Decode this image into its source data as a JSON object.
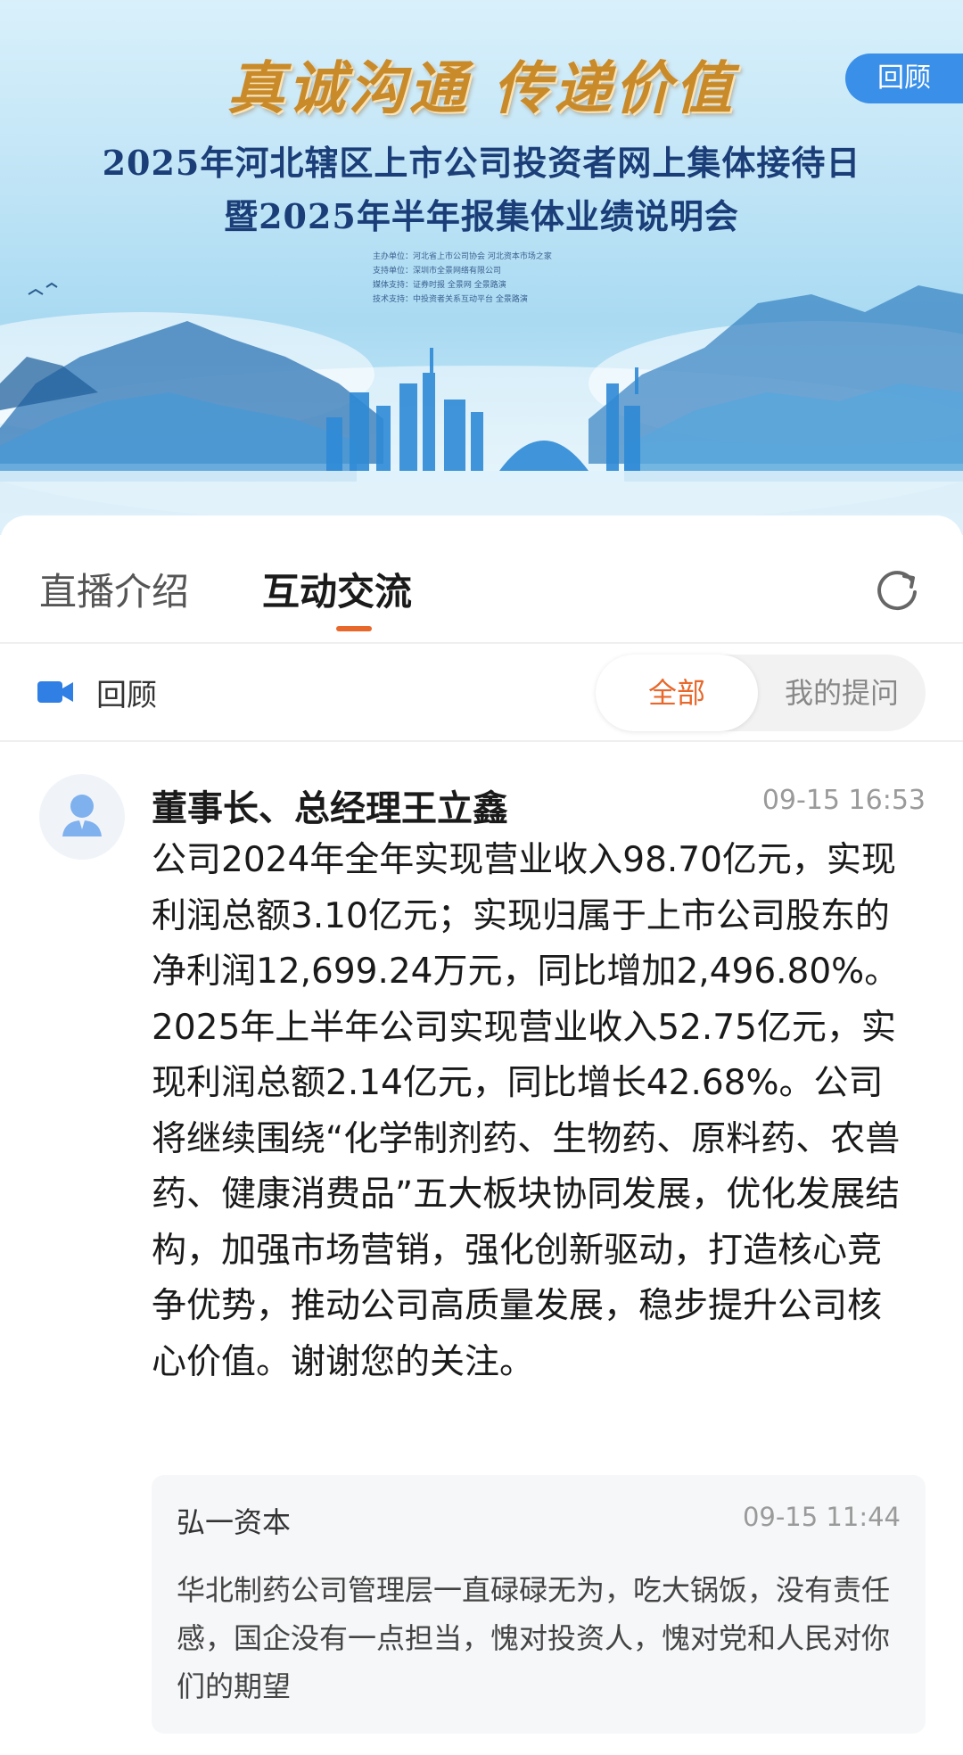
{
  "banner": {
    "slogan": "真诚沟通  传递价值",
    "title_line1": "2025年河北辖区上市公司投资者网上集体接待日",
    "title_line2": "暨2025年半年报集体业绩说明会",
    "credits": [
      "主办单位：河北省上市公司协会  河北资本市场之家",
      "支持单位：深圳市全景网络有限公司",
      "媒体支持：证券时报  全景网  全景路演",
      "技术支持：中投资者关系互动平台  全景路演"
    ],
    "review_label": "回顾"
  },
  "tabs": {
    "intro": "直播介绍",
    "interaction": "互动交流"
  },
  "filter": {
    "label": "回顾",
    "all": "全部",
    "mine": "我的提问"
  },
  "answer": {
    "author": "董事长、总经理王立鑫",
    "time": "09-15 16:53",
    "text": "公司2024年全年实现营业收入98.70亿元，实现利润总额3.10亿元；实现归属于上市公司股东的净利润12,699.24万元，同比增加2,496.80%。2025年上半年公司实现营业收入52.75亿元，实现利润总额2.14亿元，同比增长42.68%。公司将继续围绕“化学制剂药、生物药、原料药、农兽药、健康消费品”五大板块协同发展，优化发展结构，加强市场营销，强化创新驱动，打造核心竞争优势，推动公司高质量发展，稳步提升公司核心价值。谢谢您的关注。"
  },
  "question": {
    "author": "弘一资本",
    "time": "09-15 11:44",
    "text": "华北制药公司管理层一直碌碌无为，吃大锅饭，没有责任感，国企没有一点担当，愧对投资人，愧对党和人民对你们的期望"
  },
  "colors": {
    "accent": "#e8672a",
    "pill": "#3a8fe8",
    "banner_title": "#1b3e78",
    "slogan": "#c98a2a"
  },
  "icons": {
    "refresh": "refresh-icon",
    "camera": "video-camera-icon",
    "avatar": "user-avatar-icon"
  }
}
